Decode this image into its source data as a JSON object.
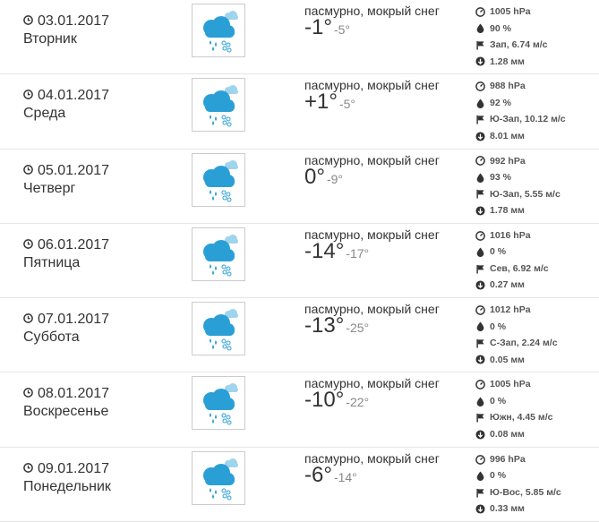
{
  "days": [
    {
      "date": "03.01.2017",
      "weekday": "Вторник",
      "condition": "пасмурно, мокрый снег",
      "temp_day": "-1°",
      "temp_night": "-5°",
      "pressure": "1005 hPa",
      "humidity": "90 %",
      "wind": "Зап, 6.74 м/с",
      "precip": "1.28 мм"
    },
    {
      "date": "04.01.2017",
      "weekday": "Среда",
      "condition": "пасмурно, мокрый снег",
      "temp_day": "+1°",
      "temp_night": "-5°",
      "pressure": "988 hPa",
      "humidity": "92 %",
      "wind": "Ю-Зап, 10.12 м/с",
      "precip": "8.01 мм"
    },
    {
      "date": "05.01.2017",
      "weekday": "Четверг",
      "condition": "пасмурно, мокрый снег",
      "temp_day": "0°",
      "temp_night": "-9°",
      "pressure": "992 hPa",
      "humidity": "93 %",
      "wind": "Ю-Зап, 5.55 м/с",
      "precip": "1.78 мм"
    },
    {
      "date": "06.01.2017",
      "weekday": "Пятница",
      "condition": "пасмурно, мокрый снег",
      "temp_day": "-14°",
      "temp_night": "-17°",
      "pressure": "1016 hPa",
      "humidity": "0 %",
      "wind": "Сев, 6.92 м/с",
      "precip": "0.27 мм"
    },
    {
      "date": "07.01.2017",
      "weekday": "Суббота",
      "condition": "пасмурно, мокрый снег",
      "temp_day": "-13°",
      "temp_night": "-25°",
      "pressure": "1012 hPa",
      "humidity": "0 %",
      "wind": "С-Зап, 2.24 м/с",
      "precip": "0.05 мм"
    },
    {
      "date": "08.01.2017",
      "weekday": "Воскресенье",
      "condition": "пасмурно, мокрый снег",
      "temp_day": "-10°",
      "temp_night": "-22°",
      "pressure": "1005 hPa",
      "humidity": "0 %",
      "wind": "Южн, 4.45 м/с",
      "precip": "0.08 мм"
    },
    {
      "date": "09.01.2017",
      "weekday": "Понедельник",
      "condition": "пасмурно, мокрый снег",
      "temp_day": "-6°",
      "temp_night": "-14°",
      "pressure": "996 hPa",
      "humidity": "0 %",
      "wind": "Ю-Вос, 5.85 м/с",
      "precip": "0.33 мм"
    }
  ],
  "icons": {
    "weather": "cloud-sleet-icon",
    "pressure": "gauge-icon",
    "humidity": "drop-icon",
    "wind": "flag-icon",
    "precip": "arrow-down-circle-icon",
    "date": "clock-icon"
  },
  "colors": {
    "cloud": "#2a9fd6",
    "cloud_light": "#9fd4ee",
    "text": "#333333",
    "muted": "#888888"
  }
}
